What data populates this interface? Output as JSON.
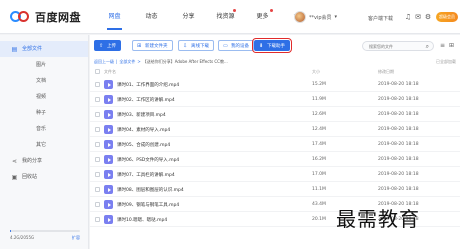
{
  "app": {
    "logo_text": "百度网盘"
  },
  "nav": [
    {
      "label": "网盘",
      "active": true,
      "dot": false
    },
    {
      "label": "动态",
      "active": false,
      "dot": false
    },
    {
      "label": "分享",
      "active": false,
      "dot": false
    },
    {
      "label": "找资源",
      "active": false,
      "dot": true
    },
    {
      "label": "更多",
      "active": false,
      "dot": true
    },
    {
      "label": "会员",
      "active": false,
      "dot": false,
      "muted": true
    }
  ],
  "header": {
    "username": "**vip会员",
    "client_label": "客户端下载",
    "vip_label": "超级会员"
  },
  "sidebar": {
    "items": [
      {
        "label": "全部文件",
        "icon": "folder-icon",
        "top": true,
        "active": true
      },
      {
        "label": "图片",
        "top": false
      },
      {
        "label": "文档",
        "top": false
      },
      {
        "label": "视频",
        "top": false
      },
      {
        "label": "种子",
        "top": false
      },
      {
        "label": "音乐",
        "top": false
      },
      {
        "label": "其它",
        "top": false
      },
      {
        "label": "我的分享",
        "icon": "share-icon",
        "top": true
      },
      {
        "label": "回收站",
        "icon": "trash-icon",
        "top": true
      }
    ],
    "quota_text": "4.2G/2055G",
    "quota_fraction": 0.002,
    "expand_label": "扩容"
  },
  "toolbar": {
    "upload": "上传",
    "new_folder": "新建文件夹",
    "offline": "离线下载",
    "my_device": "我的设备",
    "download_helper": "下载助手",
    "search_placeholder": "搜索您的文件"
  },
  "breadcrumb": {
    "back": "返回上一级",
    "root": "全部文件",
    "current": "【送给你们分享】Adobe After Effects CC教..."
  },
  "loaded_text": "已全部加载",
  "table": {
    "col_name": "文件名",
    "col_size": "大小",
    "col_date": "修改日期",
    "rows": [
      {
        "name": "课时01、工作界面的介绍.mp4",
        "size": "15.2M",
        "date": "2019-08-20 18:18"
      },
      {
        "name": "课时02、工作区的讲解.mp4",
        "size": "11.9M",
        "date": "2019-08-20 18:18"
      },
      {
        "name": "课时03、新建项目.mp4",
        "size": "12.6M",
        "date": "2019-08-20 18:18"
      },
      {
        "name": "课时04、素材的导入.mp4",
        "size": "12.4M",
        "date": "2019-08-20 18:18"
      },
      {
        "name": "课时05、合成的创建.mp4",
        "size": "17.4M",
        "date": "2019-08-20 18:18"
      },
      {
        "name": "课时06、PSD文件的导入.mp4",
        "size": "16.2M",
        "date": "2019-08-20 18:18"
      },
      {
        "name": "课时07、工具栏的讲解.mp4",
        "size": "17.0M",
        "date": "2019-08-20 18:18"
      },
      {
        "name": "课时08、图层和图层的认识.mp4",
        "size": "11.1M",
        "date": "2019-08-20 18:18"
      },
      {
        "name": "课时09、钢笔与钢笔工具.mp4",
        "size": "43.4M",
        "date": "2019-08-20 18:18"
      },
      {
        "name": "课时10.嗯嗯、嗯哒.mp4",
        "size": "20.1M",
        "date": "2019-08-20 18:18"
      }
    ]
  },
  "watermark": "最需教育",
  "colors": {
    "accent": "#2e6fe6",
    "highlight_border": "#e12b2b",
    "file_icon": "#7a7ff0"
  }
}
